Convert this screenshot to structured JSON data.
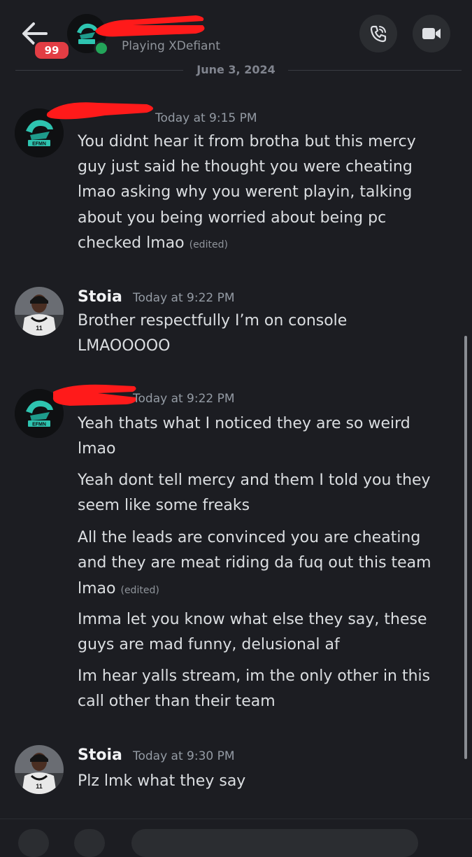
{
  "header": {
    "unread_badge": "99",
    "status": "Playing XDefiant"
  },
  "date_divider": "June 3, 2024",
  "messages": [
    {
      "timestamp": "Today at 9:15 PM",
      "lines": [
        "You didnt hear it from brotha but this mercy",
        "guy just said he thought you were cheating",
        "lmao asking why you werent playin, talking",
        "about you being worried about being pc",
        "checked lmao"
      ],
      "edited": "(edited)"
    },
    {
      "username": "Stoia",
      "timestamp": "Today at 9:22 PM",
      "lines": [
        "Brother respectfully I’m on console",
        "LMAOOOOO"
      ]
    },
    {
      "timestamp": "Today at 9:22 PM",
      "lines_a": [
        "Yeah thats what I noticed they are so weird",
        "lmao"
      ],
      "lines_b": [
        "Yeah dont tell mercy and them I told you they",
        "seem like some freaks"
      ],
      "lines_c": [
        "All the leads are convinced you are cheating",
        "and they are meat riding da fuq out this team",
        "lmao"
      ],
      "edited": "(edited)",
      "lines_d": [
        "Imma let you know what else they say, these",
        "guys are mad funny, delusional af"
      ],
      "lines_e": [
        "Im hear yalls stream, im the only other in this",
        "call other than their team"
      ]
    },
    {
      "username": "Stoia",
      "timestamp": "Today at 9:30 PM",
      "lines": [
        "Plz lmk what they say"
      ]
    }
  ],
  "colors": {
    "background": "#1c1d22",
    "badge": "#e23d44",
    "online": "#23a55a",
    "redaction": "#ff1a1a"
  },
  "icons": {
    "back": "arrow-left-icon",
    "call": "phone-icon",
    "video": "video-camera-icon"
  }
}
